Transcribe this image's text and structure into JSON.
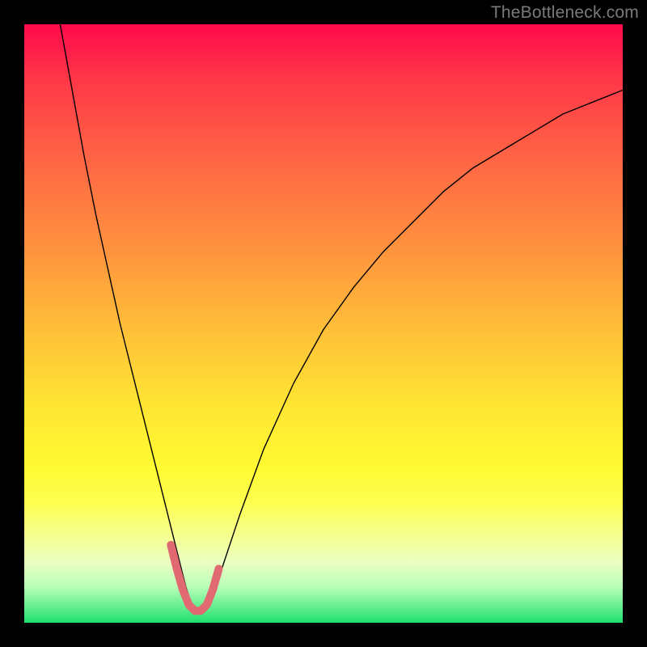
{
  "watermark": "TheBottleneck.com",
  "chart_data": {
    "type": "line",
    "title": "",
    "xlabel": "",
    "ylabel": "",
    "xlim": [
      0,
      100
    ],
    "ylim": [
      0,
      100
    ],
    "grid": false,
    "legend": false,
    "background_gradient": {
      "top": "#ff0a4a",
      "bottom": "#20e070"
    },
    "series": [
      {
        "name": "curve",
        "color": "#000000",
        "stroke_width": 1.4,
        "x": [
          6,
          8,
          10,
          12,
          14,
          16,
          18,
          20,
          22,
          24,
          25,
          26,
          27,
          28,
          29,
          30,
          31,
          32,
          34,
          36,
          40,
          45,
          50,
          55,
          60,
          65,
          70,
          75,
          80,
          85,
          90,
          95,
          100
        ],
        "values": [
          100,
          89,
          78,
          68,
          59,
          50,
          42,
          34,
          26,
          18,
          14,
          10,
          6,
          3,
          2,
          2,
          3,
          6,
          12,
          18,
          29,
          40,
          49,
          56,
          62,
          67,
          72,
          76,
          79,
          82,
          85,
          87,
          89
        ]
      },
      {
        "name": "bottom-highlight",
        "color": "#e16a72",
        "stroke_width": 10,
        "x": [
          24.5,
          25.5,
          26.5,
          27.5,
          28.5,
          29.5,
          30.5,
          31.5,
          32.5
        ],
        "values": [
          13,
          9,
          5.5,
          3,
          2,
          2,
          3,
          5.5,
          9
        ]
      }
    ]
  }
}
